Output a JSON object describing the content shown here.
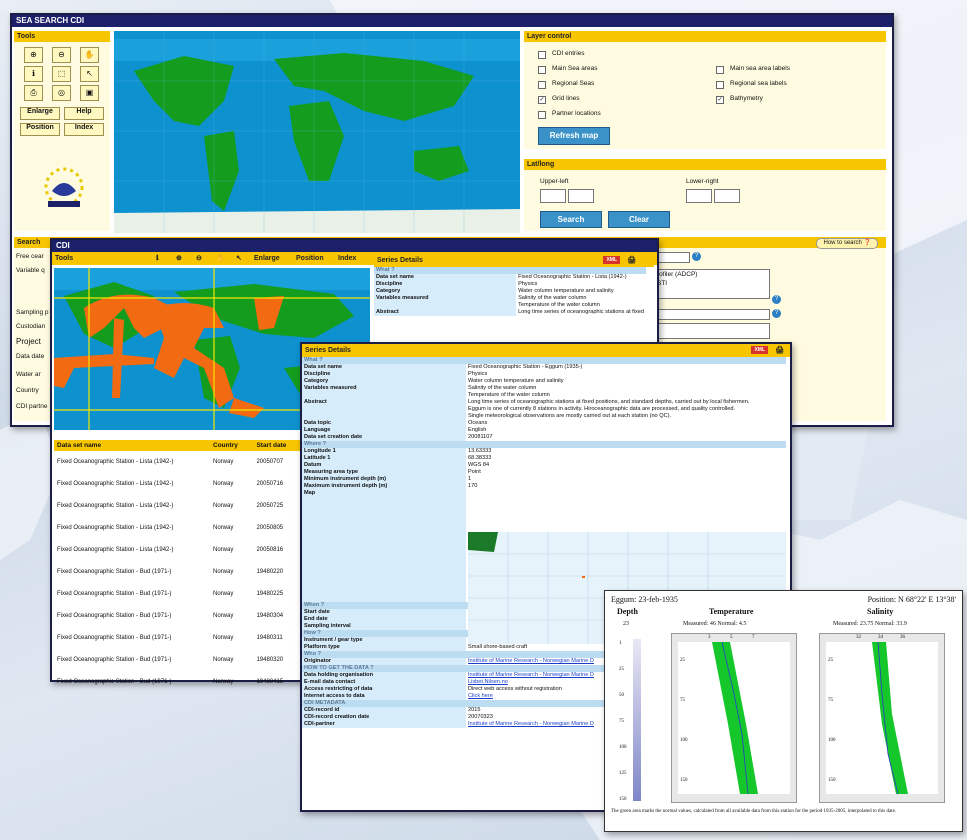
{
  "main_window": {
    "title": "SEA SEARCH CDI",
    "tools": {
      "title": "Tools",
      "enlarge": "Enlarge",
      "help": "Help",
      "position": "Position",
      "index": "Index"
    },
    "layer_control": {
      "title": "Layer control",
      "items": [
        "CDI entries",
        "Main Sea areas",
        "Regional Seas",
        "Grid lines",
        "Partner locations",
        "Main sea area labels",
        "Regional sea labels",
        "Bathymetry"
      ],
      "checked": [
        "Grid lines",
        "Bathymetry"
      ],
      "refresh": "Refresh map"
    },
    "latlong": {
      "title": "Lat/long",
      "upper_left": "Upper-left",
      "lower_right": "Lower-right",
      "search": "Search",
      "clear": "Clear"
    },
    "search": {
      "title": "Search",
      "how_to": "How to search",
      "labels": [
        "Free cear",
        "Variable q",
        "Sampling p",
        "Custodian",
        "Project",
        "Data date",
        "Water ar",
        "Country",
        "CDI partne"
      ],
      "select_vals": [
        "rofiler (ADCP)",
        "STI"
      ]
    }
  },
  "cdi_window": {
    "title": "CDI",
    "toolbar": {
      "tools": "Tools",
      "enlarge": "Enlarge",
      "position": "Position",
      "index": "Index"
    },
    "series_title": "Series Details",
    "xml": "XML",
    "table": {
      "headers": [
        "Data set name",
        "Country",
        "Start date"
      ],
      "rows": [
        [
          "Fixed Oceanographic Station - Lista (1942-)",
          "Norway",
          "20050707"
        ],
        [
          "Fixed Oceanographic Station - Lista (1942-)",
          "Norway",
          "20050716"
        ],
        [
          "Fixed Oceanographic Station - Lista (1942-)",
          "Norway",
          "20050725"
        ],
        [
          "Fixed Oceanographic Station - Lista (1942-)",
          "Norway",
          "20050805"
        ],
        [
          "Fixed Oceanographic Station - Lista (1942-)",
          "Norway",
          "20050816"
        ],
        [
          "Fixed Oceanographic Station - Bud (1971-)",
          "Norway",
          "19480220"
        ],
        [
          "Fixed Oceanographic Station - Bud (1971-)",
          "Norway",
          "19480225"
        ],
        [
          "Fixed Oceanographic Station - Bud (1971-)",
          "Norway",
          "19480304"
        ],
        [
          "Fixed Oceanographic Station - Bud (1971-)",
          "Norway",
          "19480311"
        ],
        [
          "Fixed Oceanographic Station - Bud (1971-)",
          "Norway",
          "19480320"
        ],
        [
          "Fixed Oceanographic Station - Bud (1971-)",
          "Norway",
          "19480415"
        ]
      ]
    },
    "details": [
      [
        "What ?",
        ""
      ],
      [
        "Data set name",
        "Fixed Oceanographic Station - Lista (1942-)"
      ],
      [
        "Discipline",
        "Physics"
      ],
      [
        "Category",
        "Water column temperature and salinity"
      ],
      [
        "Variables measured",
        "Salinity of the water column"
      ],
      [
        "",
        "Temperature of the water column"
      ],
      [
        "Abstract",
        "Long time series of oceanographic stations at fixed"
      ]
    ]
  },
  "series_window": {
    "title": "Series Details",
    "xml": "XML",
    "rows": [
      [
        "sec",
        "What ?",
        ""
      ],
      [
        "k",
        "Data set name",
        "Fixed Oceanographic Station - Eggum (1935-)"
      ],
      [
        "k",
        "Discipline",
        "Physics"
      ],
      [
        "k",
        "Category",
        "Water column temperature and salinity"
      ],
      [
        "k",
        "Variables measured",
        "Salinity of the water column"
      ],
      [
        "k",
        "",
        "Temperature of the water column"
      ],
      [
        "k",
        "Abstract",
        "Long time series of oceanographic stations at fixed positions, and standard depths, carried out by local fishermen."
      ],
      [
        "k",
        "",
        "Eggum is one of currently 8 stations in activity. Hiroceanographic data are processed, and quality controlled."
      ],
      [
        "k",
        "",
        "Single meteorological observations are mostly carried out at each  station (no QC)."
      ],
      [
        "k",
        "",
        ""
      ],
      [
        "k",
        "Data topic",
        "Oceans"
      ],
      [
        "k",
        "Language",
        "English"
      ],
      [
        "k",
        "Data set creation date",
        "20081107"
      ],
      [
        "sec",
        "Where ?",
        ""
      ],
      [
        "k",
        "Longitude 1",
        "13.63333"
      ],
      [
        "k",
        "Latitude 1",
        "68.38333"
      ],
      [
        "k",
        "Datum",
        "WGS 84"
      ],
      [
        "k",
        "Measuring area type",
        "Point"
      ],
      [
        "k",
        "Minimum instrument depth (m)",
        "1"
      ],
      [
        "k",
        "Maximum instrument depth (m)",
        "170"
      ],
      [
        "k",
        "Map",
        ""
      ],
      [
        "sec",
        "When ?",
        ""
      ],
      [
        "k",
        "Start date",
        "19350220"
      ],
      [
        "k",
        "End date",
        "19350220"
      ],
      [
        "k",
        "Sampling interval",
        "From weekly to less than monthly"
      ],
      [
        "sec",
        "How ?",
        ""
      ],
      [
        "k",
        "Instrument / gear type",
        "CTD profiler"
      ],
      [
        "k",
        "Platform type",
        "Small shore-based craft"
      ],
      [
        "sec",
        "Who ?",
        ""
      ],
      [
        "k",
        "Originator",
        "Institute of Marine Research - Norwegian Marine D"
      ],
      [
        "sec",
        "HOW TO GET THE DATA ?",
        ""
      ],
      [
        "k",
        "Data holding organisation",
        "Institute of Marine Research - Norwegian Marine D"
      ],
      [
        "k",
        "E-mail data contact",
        "Lisbet.Nilsen.no"
      ],
      [
        "k",
        "Access restricting of data",
        "Direct web access without registration"
      ],
      [
        "k",
        "Internet access to data",
        "Click here"
      ],
      [
        "sec",
        "CDI METADATA",
        ""
      ],
      [
        "k",
        "CDI-record id",
        "2015"
      ],
      [
        "k",
        "CDI-record creation date",
        "20070323"
      ],
      [
        "k",
        "CDI-partner",
        "Institute of Marine Research - Norwegian Marine D"
      ]
    ],
    "links": [
      "Originator",
      "Data holding organisation",
      "E-mail data contact",
      "Internet access to data",
      "CDI-partner"
    ]
  },
  "profile_window": {
    "header_left": "Eggum: 23-feb-1935",
    "header_right": "Position: N 68°22' E 13°38'",
    "col_depth": "Depth",
    "col_temp": "Temperature",
    "col_sal": "Salinity",
    "depth_top": "23",
    "temp_meta": "Measured: 46 Normal: 4.5",
    "sal_meta": "Measured: 23.75 Normal: 33.9",
    "scale_ticks": [
      "1",
      "25",
      "50",
      "75",
      "100",
      "125",
      "150"
    ],
    "temp_axis_top": [
      "3",
      "5",
      "7"
    ],
    "sal_axis_top": [
      "32",
      "34",
      "36"
    ],
    "depth_ticks": [
      "25",
      "75",
      "100",
      "150"
    ],
    "footnote": "The green area marks the normal values, calculated from all available data from this station for the period 1935-2005, interpolated to this date."
  }
}
